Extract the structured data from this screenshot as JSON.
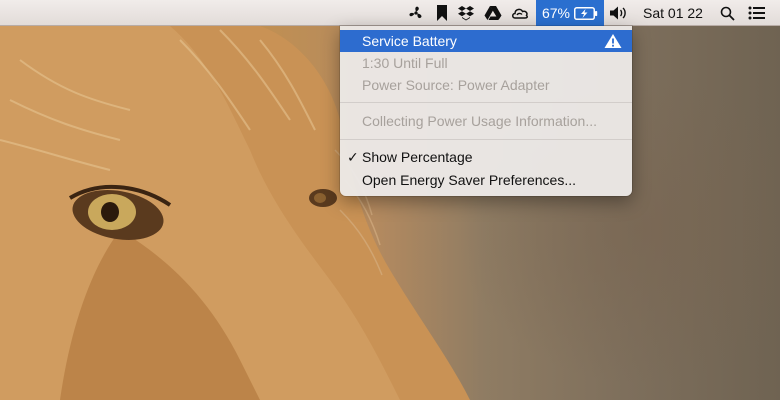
{
  "menubar": {
    "icons": [
      {
        "name": "fan-icon"
      },
      {
        "name": "bookmark-icon"
      },
      {
        "name": "dropbox-icon"
      },
      {
        "name": "google-drive-icon"
      },
      {
        "name": "cloud-sync-icon"
      }
    ],
    "battery": {
      "percent_label": "67%",
      "icon": "battery-charging-icon"
    },
    "volume_icon": "volume-icon",
    "clock": "Sat 01 22",
    "search_icon": "search-icon",
    "list_icon": "notification-list-icon"
  },
  "battery_menu": {
    "items": [
      {
        "label": "Service Battery",
        "state": "highlighted",
        "badge_icon": "warning-icon"
      },
      {
        "label": "1:30 Until Full",
        "state": "disabled"
      },
      {
        "label": "Power Source: Power Adapter",
        "state": "disabled"
      },
      {
        "label": "Collecting Power Usage Information...",
        "state": "disabled"
      },
      {
        "label": "Show Percentage",
        "state": "checked"
      },
      {
        "label": "Open Energy Saver Preferences...",
        "state": "enabled"
      }
    ]
  },
  "colors": {
    "highlight": "#2d6ccf",
    "battery_bg": "#2a6fcf",
    "disabled_text": "#a7a19c"
  }
}
